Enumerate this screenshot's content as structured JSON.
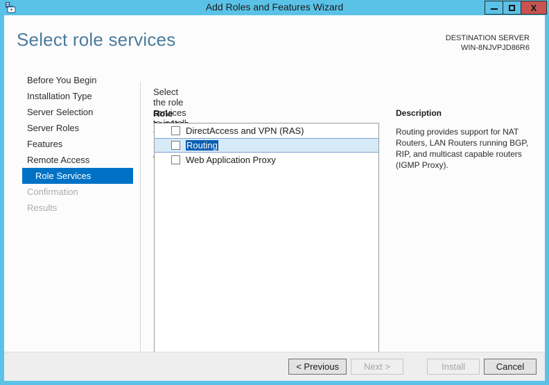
{
  "window": {
    "title": "Add Roles and Features Wizard",
    "icon": "server-wizard-icon",
    "controls": {
      "minimize": "minimize-icon",
      "maximize": "maximize-icon",
      "close": "X"
    }
  },
  "header": {
    "page_title": "Select role services",
    "destination_label": "DESTINATION SERVER",
    "destination_server": "WIN-8NJVPJD86R6"
  },
  "sidebar": {
    "items": [
      {
        "label": "Before You Begin",
        "state": "normal"
      },
      {
        "label": "Installation Type",
        "state": "normal"
      },
      {
        "label": "Server Selection",
        "state": "normal"
      },
      {
        "label": "Server Roles",
        "state": "normal"
      },
      {
        "label": "Features",
        "state": "normal"
      },
      {
        "label": "Remote Access",
        "state": "normal"
      },
      {
        "label": "Role Services",
        "state": "selected"
      },
      {
        "label": "Confirmation",
        "state": "disabled"
      },
      {
        "label": "Results",
        "state": "disabled"
      }
    ]
  },
  "main": {
    "intro_text": "Select the role services to install for Remote Access",
    "section_label": "Role services",
    "role_services": [
      {
        "label": "DirectAccess and VPN (RAS)",
        "checked": false,
        "selected": false
      },
      {
        "label": "Routing",
        "checked": false,
        "selected": true
      },
      {
        "label": "Web Application Proxy",
        "checked": false,
        "selected": false
      }
    ]
  },
  "description": {
    "title": "Description",
    "body": "Routing provides support for NAT Routers, LAN Routers running BGP, RIP, and multicast capable routers (IGMP Proxy)."
  },
  "footer": {
    "previous": "< Previous",
    "next": "Next >",
    "install": "Install",
    "cancel": "Cancel"
  },
  "colors": {
    "titlebar": "#5BC2E7",
    "accent_blue": "#0072C6",
    "selection_blue": "#0B5FB0",
    "row_highlight": "#D6EAF8",
    "close_red": "#C75450",
    "title_text_blue": "#4A7B9D"
  }
}
